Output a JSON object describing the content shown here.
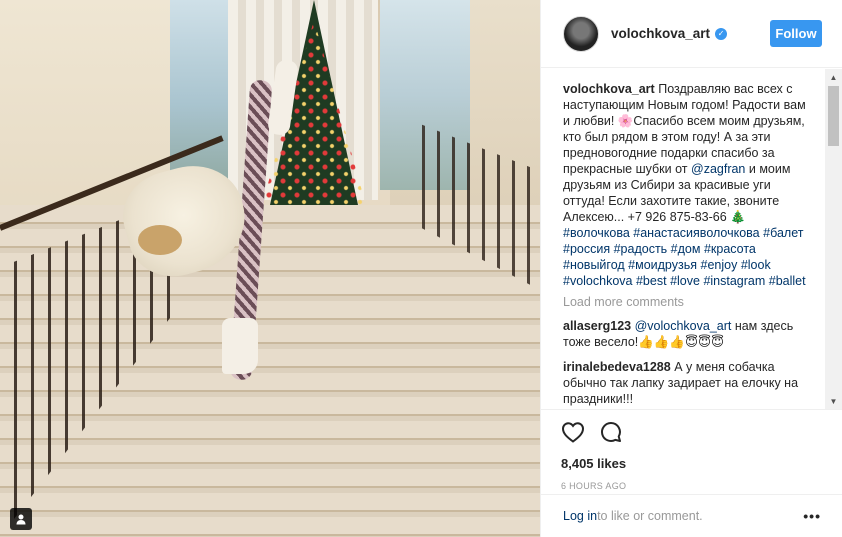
{
  "post": {
    "username": "volochkova_art",
    "verified": true,
    "follow_label": "Follow",
    "caption_user": "volochkova_art",
    "caption_part1": "Поздравляю вас всех с наступающим Новым годом! Радости вам и любви! 🌸Спасибо всем моим друзьям, кто был рядом в этом году! А за эти предновогодние подарки спасибо за прекрасные шубки от ",
    "caption_mention": "@zagfran",
    "caption_part2": " и моим друзьям из Сибири за красивые уги оттуда! Если захотите такие, звоните Алексею... +7 926 875-83-66 🎄 ",
    "hashtags": [
      "#волочкова",
      "#анастасияволочкова",
      "#балет",
      "#россия",
      "#радость",
      "#дом",
      "#красота",
      "#новыйгод",
      "#моидрузья",
      "#enjoy",
      "#look",
      "#volochkova",
      "#best",
      "#love",
      "#instagram",
      "#ballet"
    ],
    "load_more": "Load more comments",
    "comments": [
      {
        "user": "allaserg123",
        "mention": "@volochkova_art",
        "text": " нам здесь тоже весело!👍👍👍😇😇😇"
      },
      {
        "user": "irinalebedeva1288",
        "mention": "",
        "text": " А у меня собачка обычно так лапку задирает на елочку на праздники!!!"
      }
    ],
    "likes": "8,405 likes",
    "time": "6 HOURS AGO",
    "footer_login": "Log in",
    "footer_text": " to like or comment.",
    "more_label": "•••"
  },
  "icons": {
    "heart": "heart-icon",
    "comment": "comment-icon",
    "user_tag": "user-tag-icon",
    "more": "more-options-icon"
  },
  "colors": {
    "accent": "#3897f0",
    "link": "#003569",
    "muted": "#999999",
    "text": "#262626"
  }
}
